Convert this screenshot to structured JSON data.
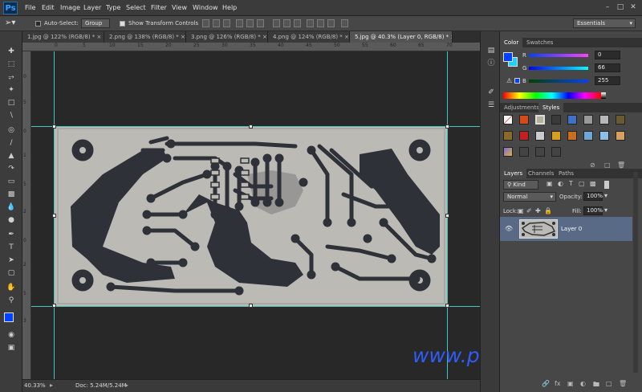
{
  "menubar": {
    "logo": "Ps",
    "items": [
      "File",
      "Edit",
      "Image",
      "Layer",
      "Type",
      "Select",
      "Filter",
      "View",
      "Window",
      "Help"
    ],
    "window_controls": [
      "–",
      "□",
      "✕"
    ]
  },
  "options": {
    "auto_select_label": "Auto-Select:",
    "auto_select_value": "Group",
    "show_transform_label": "Show Transform Controls",
    "workspace": "Essentials"
  },
  "tabs": [
    {
      "label": "1.jpg @ 122% (RGB/8) *",
      "active": false
    },
    {
      "label": "2.png @ 138% (RGB/8) *",
      "active": false
    },
    {
      "label": "3.png @ 126% (RGB/8) *",
      "active": false
    },
    {
      "label": "4.png @ 124% (RGB/8) *",
      "active": false
    },
    {
      "label": "5.jpg @ 40.3% (Layer 0, RGB/8) *",
      "active": true
    }
  ],
  "ruler": {
    "h": [
      "0",
      "5",
      "10",
      "15",
      "20",
      "25",
      "30",
      "35",
      "40",
      "45",
      "50",
      "55",
      "60",
      "65",
      "70"
    ],
    "v": [
      "0",
      "5",
      "0",
      "1",
      "5",
      "2",
      "0",
      "2",
      "5",
      "3"
    ]
  },
  "status": {
    "zoom": "40.33%",
    "doc": "Doc: 5.24M/5.24M"
  },
  "watermark": "www.praphas.com",
  "color_panel": {
    "tabs": [
      "Color",
      "Swatches"
    ],
    "r_label": "R",
    "g_label": "G",
    "b_label": "B",
    "r": "0",
    "g": "66",
    "b": "255",
    "foreground": "#0042ff",
    "background": "#1fd1ff"
  },
  "styles_panel": {
    "tabs": [
      "Adjustments",
      "Styles"
    ]
  },
  "layers_panel": {
    "tabs": [
      "Layers",
      "Channels",
      "Paths"
    ],
    "kind": "Kind",
    "blend": "Normal",
    "opacity_label": "Opacity:",
    "opacity": "100%",
    "lock_label": "Lock:",
    "fill_label": "Fill:",
    "fill": "100%",
    "layer_name": "Layer 0"
  },
  "colors": {
    "guide": "#41c7c2",
    "trace": "#2f3138",
    "board": "#b9b9b4",
    "selection": "#586a86"
  }
}
